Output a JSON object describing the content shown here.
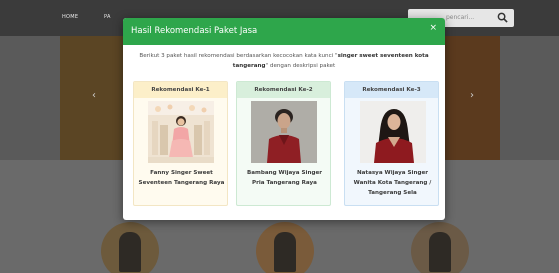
{
  "background": {
    "nav": {
      "home": "HOME",
      "second": "PA"
    },
    "search_placeholder": "pencari..."
  },
  "modal": {
    "title": "Hasil Rekomendasi Paket Jasa",
    "close_glyph": "×",
    "intro_before": "Berikut 3 paket hasil rekomendasi berdasarkan kecocokan kata kunci \"",
    "intro_keyword": "singer sweet seventeen kota tangerang",
    "intro_after": "\" dengan deskripsi paket",
    "cards": [
      {
        "heading": "Rekomendasi Ke-1",
        "name": "Fanny Singer Sweet Seventeen Tangerang Raya"
      },
      {
        "heading": "Rekomendasi Ke-2",
        "name": "Bambang Wijaya Singer Pria Tangerang Raya"
      },
      {
        "heading": "Rekomendasi Ke-3",
        "name": "Natasya Wijaya Singer Wanita Kota Tangerang / Tangerang Sela"
      }
    ]
  },
  "colors": {
    "header_green": "#2ea64b",
    "card1_head": "#fcefc9",
    "card2_head": "#d8efdc",
    "card3_head": "#d6e8f8"
  }
}
